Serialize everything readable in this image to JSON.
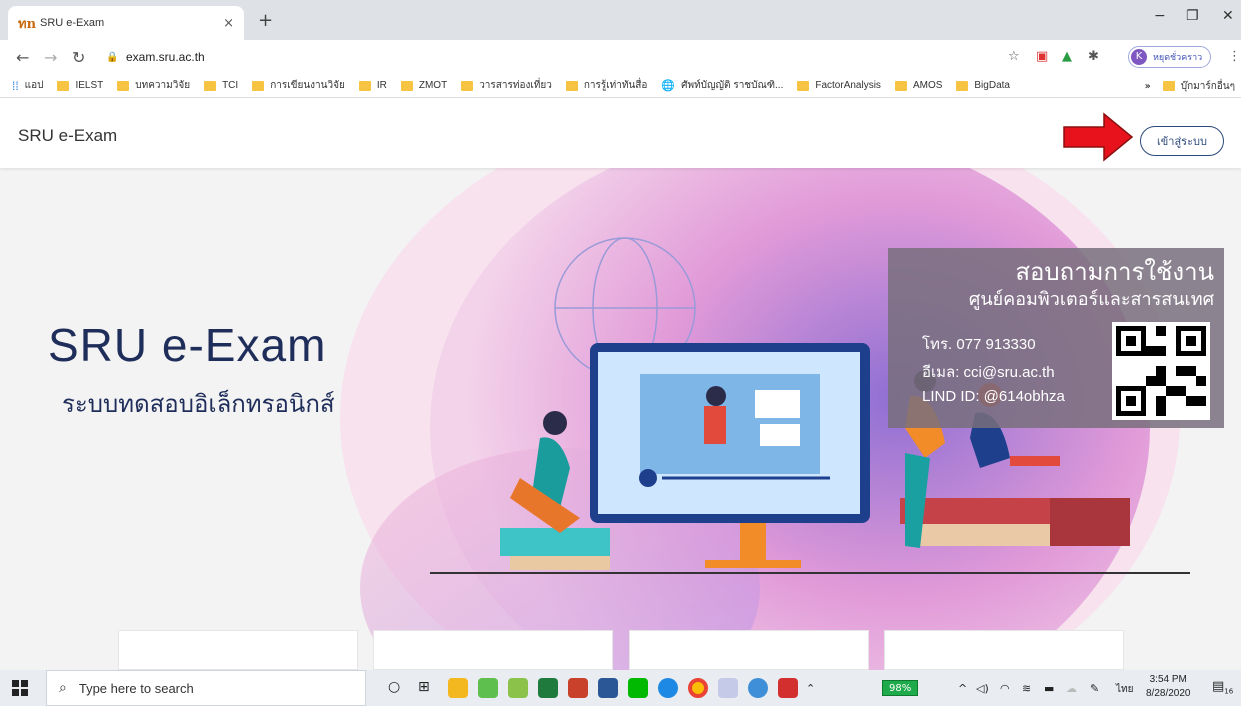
{
  "browser": {
    "tab_title": "SRU e-Exam",
    "tab_favicon": "ทn",
    "tab_close": "×",
    "new_tab": "+",
    "window_controls": {
      "minimize": "−",
      "restore": "❐",
      "close": "✕"
    },
    "url": "exam.sru.ac.th",
    "profile_initial": "K",
    "profile_label": "หยุดชั่วคราว",
    "bookmarks": [
      {
        "label": "แอป",
        "icon": "apps-grid-icon"
      },
      {
        "label": "IELST",
        "icon": "folder-icon"
      },
      {
        "label": "บทความวิจัย",
        "icon": "folder-icon"
      },
      {
        "label": "TCI",
        "icon": "folder-icon"
      },
      {
        "label": "การเขียนงานวิจัย",
        "icon": "folder-icon"
      },
      {
        "label": "IR",
        "icon": "folder-icon"
      },
      {
        "label": "ZMOT",
        "icon": "folder-icon"
      },
      {
        "label": "วารสารท่องเที่ยว",
        "icon": "folder-icon"
      },
      {
        "label": "การรู้เท่าทันสื่อ",
        "icon": "folder-icon"
      },
      {
        "label": "ศัพท์บัญญัติ ราชบัณฑิ...",
        "icon": "globe-icon"
      },
      {
        "label": "FactorAnalysis",
        "icon": "folder-icon"
      },
      {
        "label": "AMOS",
        "icon": "folder-icon"
      },
      {
        "label": "BigData",
        "icon": "folder-icon"
      }
    ],
    "bookmarks_overflow": "»",
    "other_bookmarks": "บุ๊กมาร์กอื่นๆ"
  },
  "page": {
    "brand": "SRU e-Exam",
    "login_button": "เข้าสู่ระบบ",
    "hero_title": "SRU e-Exam",
    "hero_subtitle": "ระบบทดสอบอิเล็กทรอนิกส์",
    "info_box": {
      "heading": "สอบถามการใช้งาน",
      "subheading": "ศูนย์คอมพิวเตอร์และสารสนเทศ",
      "phone": "โทร. 077 913330",
      "email": "อีเมล: cci@sru.ac.th",
      "line": "LIND ID: @614obhza"
    },
    "accent_color": "#1f2d5a"
  },
  "taskbar": {
    "search_placeholder": "Type here to search",
    "battery": "98%",
    "language": "ไทย",
    "time": "3:54 PM",
    "date": "8/28/2020",
    "notifications": "16"
  }
}
